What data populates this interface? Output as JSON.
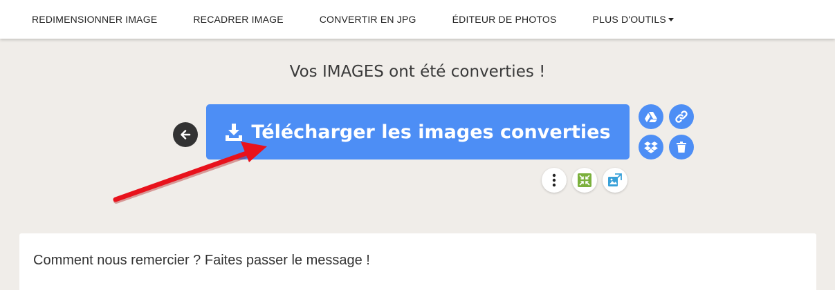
{
  "nav": {
    "items": [
      "REDIMENSIONNER IMAGE",
      "RECADRER IMAGE",
      "CONVERTIR EN JPG",
      "ÉDITEUR DE PHOTOS",
      "PLUS D'OUTILS"
    ]
  },
  "main": {
    "headline": "Vos IMAGES ont été converties !",
    "download_label": "Télécharger les images converties"
  },
  "icons": {
    "back": "arrow-left-icon",
    "download": "download-icon",
    "drive": "google-drive-icon",
    "link": "link-icon",
    "dropbox": "dropbox-icon",
    "delete": "trash-icon",
    "more": "more-vertical-icon",
    "compress": "compress-icon",
    "resize": "resize-icon"
  },
  "colors": {
    "accent": "#4d8ef5",
    "arrow": "#e8121c",
    "background": "#f0ede9"
  },
  "card": {
    "title": "Comment nous remercier ? Faites passer le message !"
  }
}
